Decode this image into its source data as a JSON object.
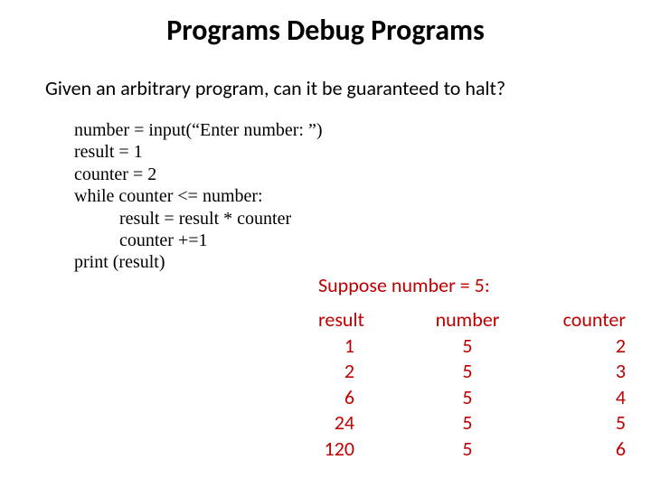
{
  "title": "Programs Debug Programs",
  "question": "Given an arbitrary program, can it be guaranteed to halt?",
  "code": {
    "l1": "number = input(“Enter number: ”)",
    "l2": "result = 1",
    "l3": "counter = 2",
    "l4": "while counter <= number:",
    "l5": "          result = result * counter",
    "l6": "          counter +=1",
    "l7": "print (result)"
  },
  "suppose": "Suppose number = 5:",
  "trace": {
    "headers": {
      "result": "result",
      "number": "number",
      "counter": "counter"
    },
    "rows": [
      {
        "result": "1",
        "number": "5",
        "counter": "2"
      },
      {
        "result": "2",
        "number": "5",
        "counter": "3"
      },
      {
        "result": "6",
        "number": "5",
        "counter": "4"
      },
      {
        "result": "24",
        "number": "5",
        "counter": "5"
      },
      {
        "result": "120",
        "number": "5",
        "counter": "6"
      }
    ]
  }
}
